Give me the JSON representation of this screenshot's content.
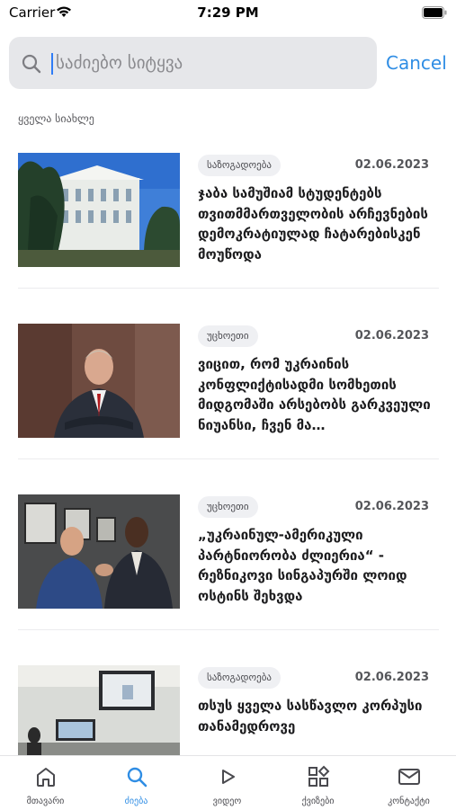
{
  "status_bar": {
    "carrier": "Carrier",
    "time": "7:29 PM"
  },
  "search": {
    "placeholder": "საძიებო სიტყვა",
    "value": "",
    "cancel_label": "Cancel"
  },
  "section": {
    "label": "ყველა სიახლე"
  },
  "articles": [
    {
      "category": "საზოგადოება",
      "date": "02.06.2023",
      "title": "ჯაბა სამუშიამ სტუდენტებს თვითმმართველობის არჩევნების დემოკრატიულად ჩატარებისკენ მოუწოდა",
      "image": "university-building-photo"
    },
    {
      "category": "უცხოეთი",
      "date": "02.06.2023",
      "title": "ვიცით, რომ უკრაინის კონფლიქტისადმი სომხეთის მიდგომაში არსებობს გარკვეული ნიუანსი, ჩვენ მა…",
      "image": "official-portrait-photo"
    },
    {
      "category": "უცხოეთი",
      "date": "02.06.2023",
      "title": "„უკრაინულ-ამერიკული პარტნიორობა ძლიერია“ - რეზნიკოვი სინგაპურში ლოიდ ოსტინს შეხვდა",
      "image": "handshake-meeting-photo"
    },
    {
      "category": "საზოგადოება",
      "date": "02.06.2023",
      "title": "თსუს ყველა სასწავლო კორპუსი თანამედროვე",
      "image": "lecture-hall-photo"
    }
  ],
  "tabs": [
    {
      "label": "მთავარი",
      "icon": "home-icon",
      "active": false
    },
    {
      "label": "ძიება",
      "icon": "search-icon",
      "active": true
    },
    {
      "label": "ვიდეო",
      "icon": "play-icon",
      "active": false
    },
    {
      "label": "ქვიზები",
      "icon": "grid-icon",
      "active": false
    },
    {
      "label": "კონტაქტი",
      "icon": "mail-icon",
      "active": false
    }
  ],
  "colors": {
    "accent": "#2f8de4",
    "search_bg": "#e6e7ea",
    "badge_bg": "#eff0f3"
  }
}
